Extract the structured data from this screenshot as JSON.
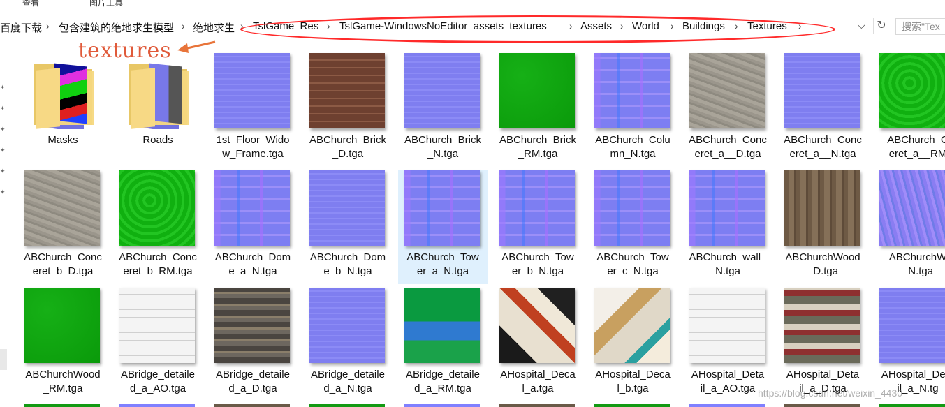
{
  "ribbon": {
    "tab_view": "查看",
    "tab_picture_tools": "图片工具"
  },
  "address_bar": {
    "breadcrumbs": [
      "百度下载",
      "包含建筑的绝地求生模型",
      "绝地求生",
      "TslGame_Res",
      "TslGame-WindowsNoEditor_assets_textures",
      "Assets",
      "World",
      "Buildings",
      "Textures"
    ],
    "search_placeholder": "搜索\"Tex"
  },
  "annotation": {
    "text": "textures",
    "color": "#e05a3a",
    "oval_color": "#ff2a2a"
  },
  "items": [
    {
      "l1": "Masks",
      "l2": "",
      "kind": "folder",
      "thumb": "mask"
    },
    {
      "l1": "Roads",
      "l2": "",
      "kind": "folder",
      "thumb": "roadn"
    },
    {
      "l1": "1st_Floor_Wido",
      "l2": "w_Frame.tga",
      "kind": "file",
      "thumb": "normal"
    },
    {
      "l1": "ABChurch_Brick",
      "l2": "_D.tga",
      "kind": "file",
      "thumb": "brick"
    },
    {
      "l1": "ABChurch_Brick",
      "l2": "_N.tga",
      "kind": "file",
      "thumb": "normal"
    },
    {
      "l1": "ABChurch_Brick",
      "l2": "_RM.tga",
      "kind": "file",
      "thumb": "green"
    },
    {
      "l1": "ABChurch_Colu",
      "l2": "mn_N.tga",
      "kind": "file",
      "thumb": "normal2"
    },
    {
      "l1": "ABChurch_Conc",
      "l2": "eret_a__D.tga",
      "kind": "file",
      "thumb": "concrete"
    },
    {
      "l1": "ABChurch_Conc",
      "l2": "eret_a__N.tga",
      "kind": "file",
      "thumb": "normal"
    },
    {
      "l1": "ABChurch_C",
      "l2": "eret_a__RM",
      "kind": "file",
      "thumb": "green2"
    },
    {
      "l1": "ABChurch_Conc",
      "l2": "eret_b_D.tga",
      "kind": "file",
      "thumb": "concrete"
    },
    {
      "l1": "ABChurch_Conc",
      "l2": "eret_b_RM.tga",
      "kind": "file",
      "thumb": "green2"
    },
    {
      "l1": "ABChurch_Dom",
      "l2": "e_a_N.tga",
      "kind": "file",
      "thumb": "normal2"
    },
    {
      "l1": "ABChurch_Dom",
      "l2": "e_b_N.tga",
      "kind": "file",
      "thumb": "normal"
    },
    {
      "l1": "ABChurch_Tow",
      "l2": "er_a_N.tga",
      "kind": "file",
      "thumb": "normal2",
      "selected": true
    },
    {
      "l1": "ABChurch_Tow",
      "l2": "er_b_N.tga",
      "kind": "file",
      "thumb": "normal2"
    },
    {
      "l1": "ABChurch_Tow",
      "l2": "er_c_N.tga",
      "kind": "file",
      "thumb": "normal2"
    },
    {
      "l1": "ABChurch_wall_",
      "l2": "N.tga",
      "kind": "file",
      "thumb": "normal2"
    },
    {
      "l1": "ABChurchWood",
      "l2": "_D.tga",
      "kind": "file",
      "thumb": "wood"
    },
    {
      "l1": "ABChurchW",
      "l2": "_N.tga",
      "kind": "file",
      "thumb": "normal3"
    },
    {
      "l1": "ABChurchWood",
      "l2": "_RM.tga",
      "kind": "file",
      "thumb": "green"
    },
    {
      "l1": "ABridge_detaile",
      "l2": "d_a_AO.tga",
      "kind": "file",
      "thumb": "ao"
    },
    {
      "l1": "ABridge_detaile",
      "l2": "d_a_D.tga",
      "kind": "file",
      "thumb": "bridge"
    },
    {
      "l1": "ABridge_detaile",
      "l2": "d_a_N.tga",
      "kind": "file",
      "thumb": "normal"
    },
    {
      "l1": "ABridge_detaile",
      "l2": "d_a_RM.tga",
      "kind": "file",
      "thumb": "rm"
    },
    {
      "l1": "AHospital_Deca",
      "l2": "l_a.tga",
      "kind": "file",
      "thumb": "decal"
    },
    {
      "l1": "AHospital_Deca",
      "l2": "l_b.tga",
      "kind": "file",
      "thumb": "decal2"
    },
    {
      "l1": "AHospital_Deta",
      "l2": "il_a_AO.tga",
      "kind": "file",
      "thumb": "ao"
    },
    {
      "l1": "AHospital_Deta",
      "l2": "il_a_D.tga",
      "kind": "file",
      "thumb": "hospd"
    },
    {
      "l1": "AHospital_Deta",
      "l2": "il_a_N.tg",
      "kind": "file",
      "thumb": "normal"
    }
  ],
  "watermark": "https://blog.csdn.net/weixin_4430"
}
